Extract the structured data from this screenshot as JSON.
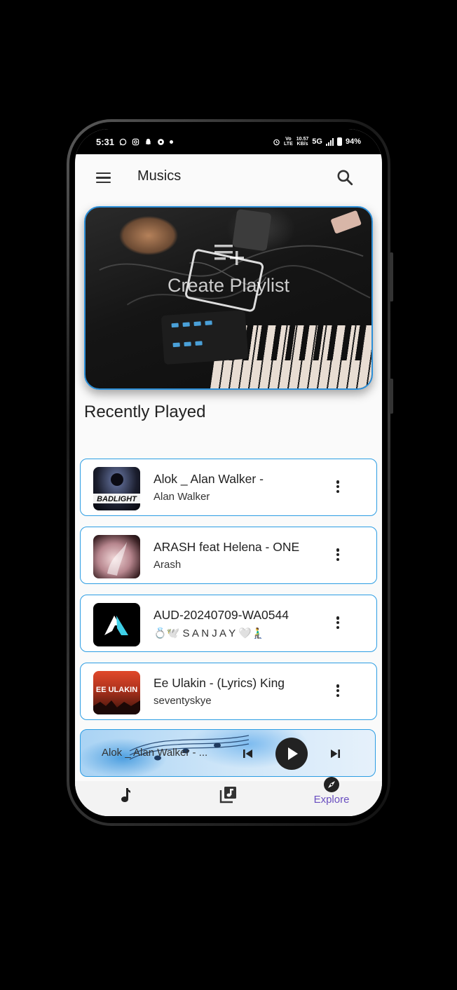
{
  "status_bar": {
    "time": "5:31",
    "network_speed": "10.57",
    "network_unit": "KB/s",
    "network_type": "5G",
    "battery": "94%"
  },
  "app_bar": {
    "title": "Musics"
  },
  "banner": {
    "label": "Create Playlist"
  },
  "recently_played": {
    "title": "Recently Played",
    "songs": [
      {
        "title": "Alok _ Alan Walker -",
        "artist": "Alan Walker",
        "thumb_text": "BADLIGHT"
      },
      {
        "title": "ARASH feat Helena - ONE",
        "artist": "Arash"
      },
      {
        "title": "AUD-20240709-WA0544",
        "artist": "💍🕊️ S A N J A Y 🤍🧎‍♂️"
      },
      {
        "title": "Ee Ulakin - (Lyrics) King",
        "artist": "seventyskye",
        "thumb_text": "EE ULAKIN"
      }
    ]
  },
  "mini_player": {
    "title": "Alok _ Alan Walker - ..."
  },
  "bottom_nav": {
    "items": [
      {
        "label": "",
        "icon": "music-note-icon"
      },
      {
        "label": "",
        "icon": "library-music-icon"
      },
      {
        "label": "Explore",
        "icon": "compass-icon"
      }
    ]
  },
  "colors": {
    "accent": "#2c9de3",
    "nav_active": "#6a4fc0"
  }
}
